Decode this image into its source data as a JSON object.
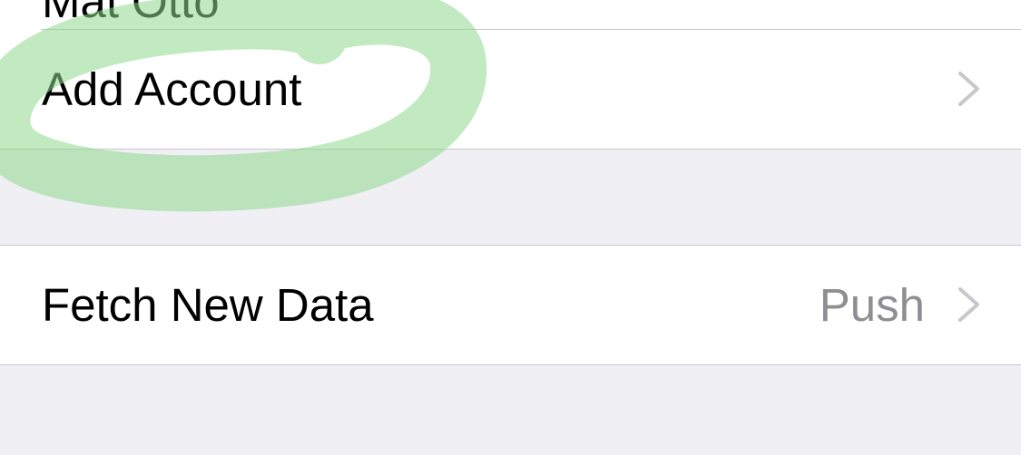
{
  "rows": {
    "partial_label": "Mat Otto",
    "add_account_label": "Add Account",
    "fetch_new_data_label": "Fetch New Data",
    "fetch_new_data_value": "Push"
  },
  "icons": {
    "chevron": "chevron-right-icon"
  },
  "colors": {
    "background": "#efeff4",
    "cell_background": "#ffffff",
    "separator": "#c8c7cc",
    "detail_text": "#8e8e93",
    "chevron": "#c7c7cc",
    "highlight_marker": "#8ed88e"
  }
}
